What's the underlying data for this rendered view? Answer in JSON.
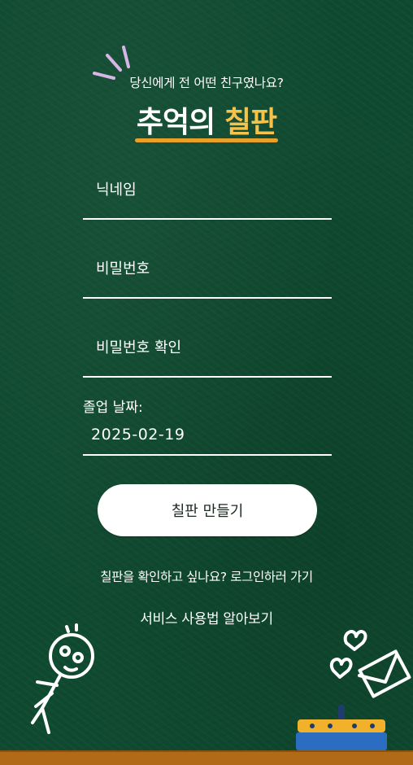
{
  "header": {
    "subtitle": "당신에게 전 어떤 친구였나요?",
    "title_part1": "추억의",
    "title_part2": "칠판"
  },
  "form": {
    "nickname_placeholder": "닉네임",
    "password_placeholder": "비밀번호",
    "password_confirm_placeholder": "비밀번호 확인",
    "graduation_label": "졸업 날짜:",
    "graduation_value": "2025-02-19",
    "submit_label": "칠판 만들기"
  },
  "links": {
    "login": "칠판을 확인하고 싶나요? 로그인하러 가기",
    "guide": "서비스 사용법 알아보기"
  },
  "colors": {
    "board": "#0f4a30",
    "accent": "#f6c24a",
    "underline": "#e7a12a",
    "ledge": "#b06a18"
  },
  "icons": [
    "sparkle-icon",
    "stickman-doodle",
    "heart-icon",
    "envelope-icon",
    "cake-icon"
  ]
}
